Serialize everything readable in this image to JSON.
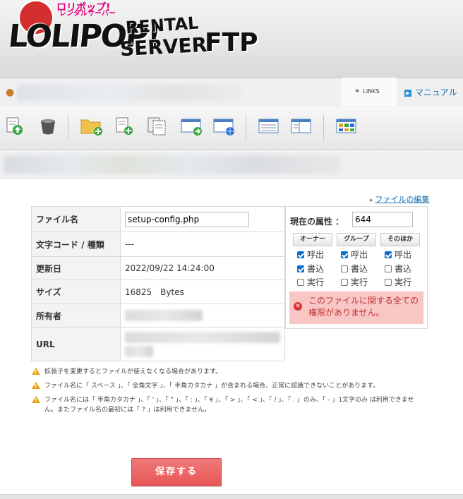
{
  "logo": {
    "badge": "ロリポップ!",
    "sub": "レンタルサーバー",
    "main": "LOLIPOP!",
    "rental": "RENTAL",
    "server": "SERVER",
    "ftp": "FTP"
  },
  "header_links": {
    "links": "LINKS",
    "manual": "マニュアル"
  },
  "toolbar_icons": [
    "upload-file-icon",
    "trash-icon",
    "new-folder-icon",
    "new-file-icon",
    "copy-icon",
    "move-icon",
    "web-icon",
    "list-view-icon",
    "split-view-icon",
    "thumbnail-view-icon"
  ],
  "edit_link": "ファイルの編集",
  "info": {
    "filename_label": "ファイル名",
    "filename_value": "setup-config.php",
    "encoding_label": "文字コード / 種類",
    "encoding_value": "---",
    "date_label": "更新日",
    "date_value": "2022/09/22 14:24:00",
    "size_label": "サイズ",
    "size_value": "16825　Bytes",
    "owner_label": "所有者",
    "url_label": "URL"
  },
  "permissions": {
    "title": "現在の属性 ：",
    "value": "644",
    "headers": [
      "オーナー",
      "グループ",
      "そのほか"
    ],
    "rows": [
      {
        "label": "呼出",
        "checked": [
          true,
          true,
          true
        ]
      },
      {
        "label": "書込",
        "checked": [
          true,
          false,
          false
        ]
      },
      {
        "label": "実行",
        "checked": [
          false,
          false,
          false
        ]
      }
    ],
    "error": "このファイルに関する全ての権限がありません。"
  },
  "notes": [
    "拡張子を変更するとファイルが使えなくなる場合があります。",
    "ファイル名に「 スペース 」、「 全角文字 」、「 半角カタカナ 」が含まれる場合、正常に認識できないことがあります。",
    "ファイル名には「 半角カタカナ 」、「 ' 」、「 \" 」、「 : 」、「 ¥ 」、「 > 」、「 < 」、「 / 」、「 . 」のみ、「 - 」1文字のみ は利用できません。またファイル名の最初には「 ? 」は利用できません。"
  ],
  "save_button": "保存する",
  "colors": {
    "accent_link": "#1a6fb0",
    "error_bg": "#f9c6c6",
    "error_text": "#c03030",
    "save_button": "#e85656",
    "checkbox": "#0a6ed1"
  }
}
